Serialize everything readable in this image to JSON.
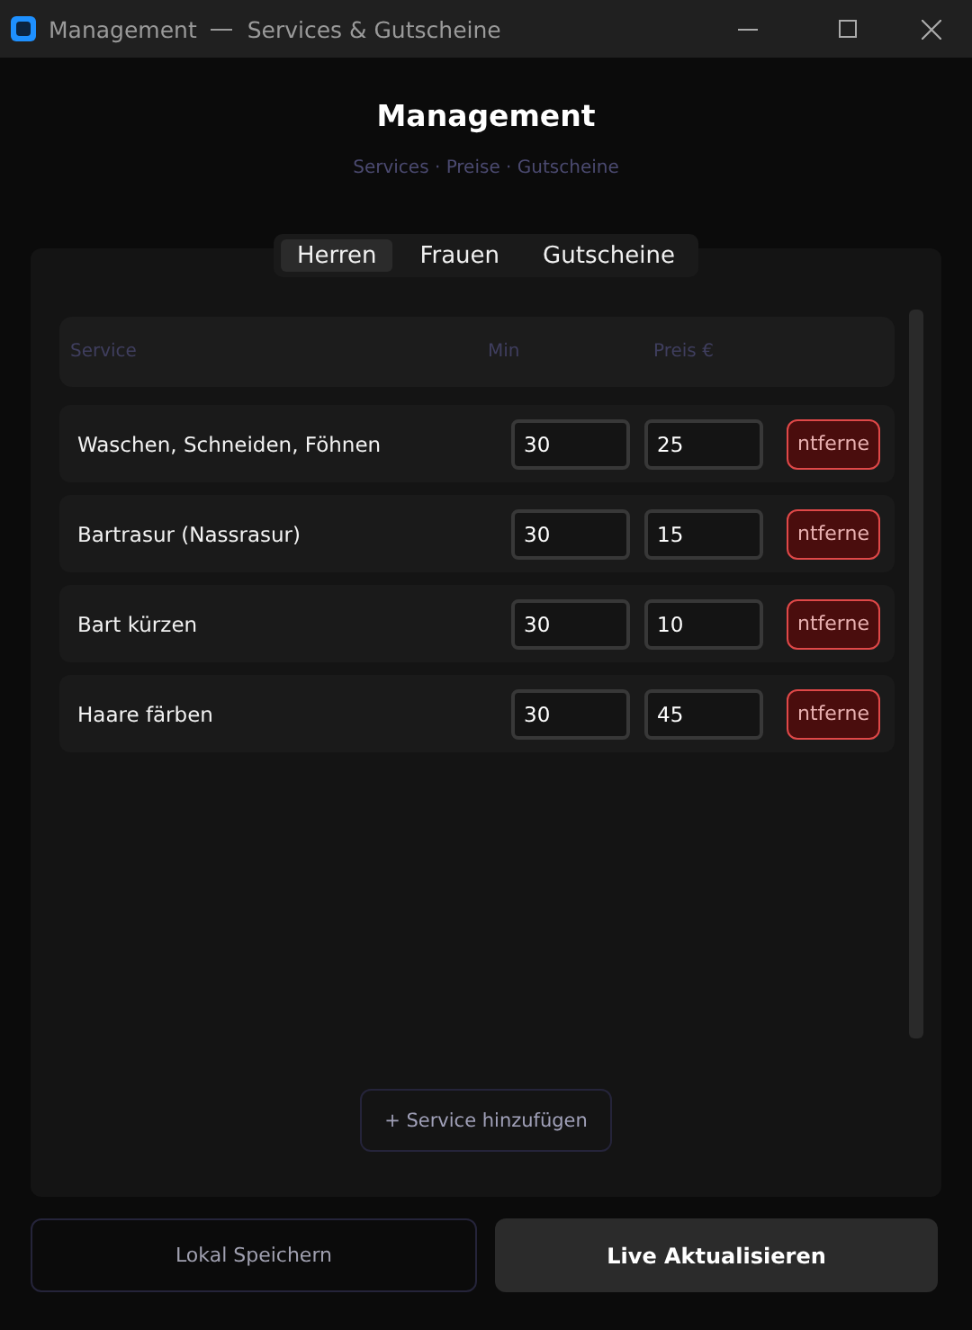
{
  "window": {
    "title": "Management",
    "subtitle": "Services & Gutscheine"
  },
  "heading": "Management",
  "subheading": "Services · Preise · Gutscheine",
  "tabs": [
    {
      "label": "Herren",
      "selected": true
    },
    {
      "label": "Frauen",
      "selected": false
    },
    {
      "label": "Gutscheine",
      "selected": false
    }
  ],
  "table": {
    "columns": [
      "Service",
      "Min",
      "Preis €"
    ],
    "rows": [
      {
        "service": "Waschen, Schneiden, Föhnen",
        "min": "30",
        "price": "25",
        "action": "ntferne"
      },
      {
        "service": "Bartrasur (Nassrasur)",
        "min": "30",
        "price": "15",
        "action": "ntferne"
      },
      {
        "service": "Bart kürzen",
        "min": "30",
        "price": "10",
        "action": "ntferne"
      },
      {
        "service": "Haare färben",
        "min": "30",
        "price": "45",
        "action": "ntferne"
      }
    ]
  },
  "add_button": "+ Service hinzufügen",
  "footer_buttons": [
    {
      "label": "Lokal Speichern",
      "kind": "secondary"
    },
    {
      "label": "Live Aktualisieren",
      "kind": "primary"
    }
  ]
}
